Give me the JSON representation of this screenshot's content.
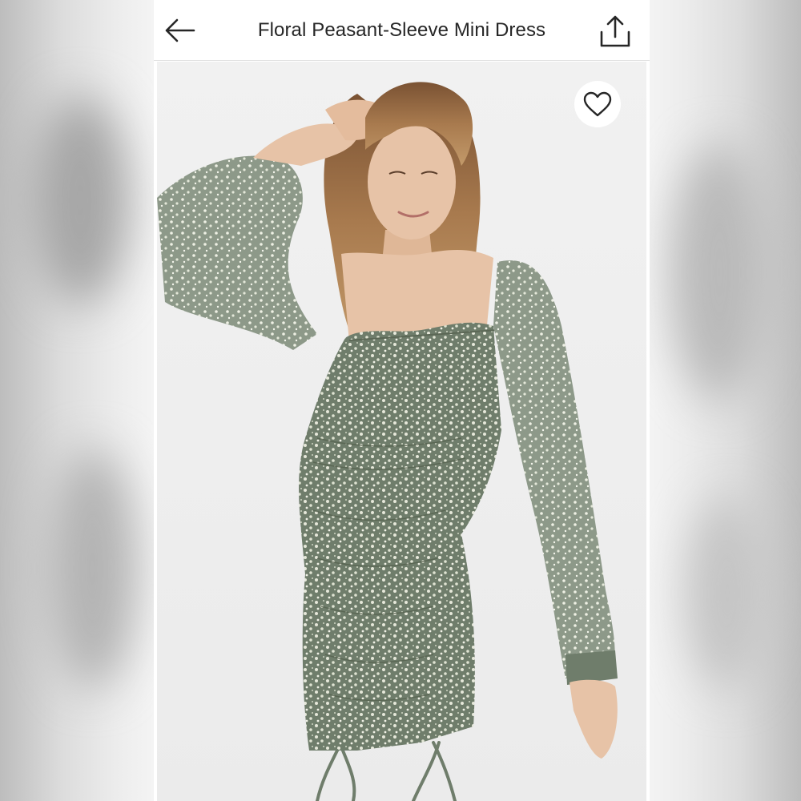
{
  "header": {
    "title": "Floral Peasant-Sleeve Mini Dress",
    "back_icon": "arrow-left-icon",
    "share_icon": "share-upload-icon"
  },
  "product_image": {
    "favorite_icon": "heart-outline-icon",
    "dress_color": "#7d8a79",
    "skin_color": "#e7c3a7",
    "hair_color": "#9a6d45"
  }
}
